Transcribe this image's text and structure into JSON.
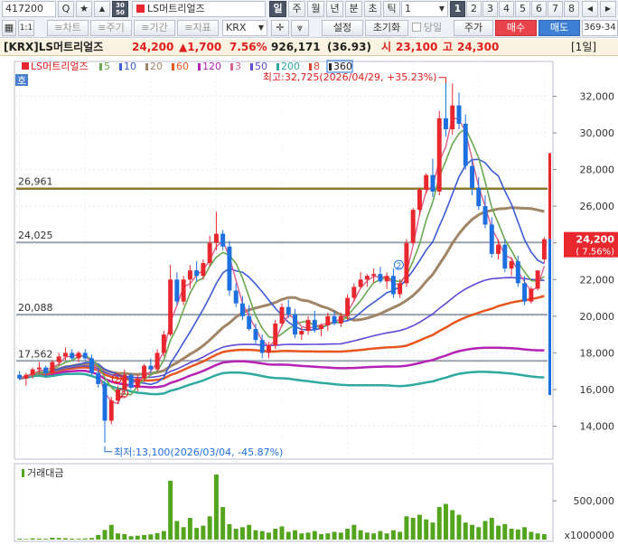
{
  "toolbar": {
    "code": "417200",
    "search_glyph": "Q",
    "star_glyph": "★",
    "up_glyph": "▲",
    "badge_top": "30",
    "badge_bottom": "50",
    "stock_name": "LS머트리얼즈",
    "period_buttons": [
      "일",
      "주",
      "월",
      "년",
      "분",
      "초",
      "틱"
    ],
    "interval_value": "1",
    "page_buttons": [
      "1",
      "2",
      "3",
      "4",
      "5",
      "6",
      "7",
      "8"
    ],
    "chart_btn": "≡차트",
    "cycle_btn": "≡주기",
    "range_btn": "≡기간",
    "indicator_btn": "≡지표",
    "market": "KRX",
    "settings_btn": "설정",
    "reset_btn": "초기화",
    "today_label": "당일",
    "price_btn": "주가",
    "buy_btn": "매수",
    "sell_btn": "매도",
    "range_label": "369-34",
    "small_btn": "1:1"
  },
  "info": {
    "exchange_name": "[KRX]LS머트리얼즈",
    "price": "24,200",
    "change": "▲1,700",
    "change_pct": "7.56%",
    "volume": "926,171",
    "turnover": "(36.93)",
    "open_label": "시",
    "open": "23,100",
    "high_label": "고",
    "high": "24,300",
    "period_tag": "[1일]"
  },
  "legend": {
    "name": "LS머트리얼즈",
    "ma": [
      {
        "label": "5",
        "color": "#6aa84f"
      },
      {
        "label": "10",
        "color": "#3d5bd6"
      },
      {
        "label": "20",
        "color": "#a08566"
      },
      {
        "label": "60",
        "color": "#e8561e"
      },
      {
        "label": "120",
        "color": "#b522b5"
      },
      {
        "label": "3",
        "color": "#e05f8a"
      },
      {
        "label": "50",
        "color": "#5b4bd6"
      },
      {
        "label": "200",
        "color": "#2eaaa0"
      },
      {
        "label": "8",
        "color": "#d9452f"
      },
      {
        "label": "360",
        "color": "#222222"
      }
    ],
    "small_tag": "호"
  },
  "annotations": {
    "high_note": "최고:32,725(2026/04/29, +35.23%)",
    "low_note": "최저:13,100(2026/03/04, -45.87%)",
    "marker_2": "2"
  },
  "volume_panel": {
    "title": "거래대금",
    "unit": "x1000000",
    "tick_label": "500,000"
  },
  "colors": {
    "up": "#e8282e",
    "down": "#1e6fe0",
    "volume": "#52a51c",
    "hline_olive": "#8c7a2c",
    "hline_grey": "#9aa3ad"
  },
  "chart_data": {
    "type": "candlestick",
    "y_ticks": [
      14000,
      16000,
      18000,
      20000,
      22000,
      24000,
      26000,
      28000,
      30000,
      32000
    ],
    "y_tick_labels": [
      "14,000",
      "16,000",
      "18,000",
      "20,000",
      "22,000",
      "24,000",
      "26,000",
      "28,000",
      "30,000",
      "32,000"
    ],
    "ylim": [
      12300,
      33800
    ],
    "hlines": [
      {
        "value": 26961,
        "label": "26,961",
        "color": "#8c7a2c"
      },
      {
        "value": 24025,
        "label": "24,025",
        "color": "#9aa3ad"
      },
      {
        "value": 20088,
        "label": "20,088",
        "color": "#9aa3ad"
      },
      {
        "value": 17562,
        "label": "17,562",
        "color": "#9aa3ad"
      }
    ],
    "current_price_label": [
      "24,200",
      "( 7.56%)"
    ],
    "current_price": 24200,
    "candles": [
      [
        16800,
        17000,
        16500,
        16600
      ],
      [
        16600,
        16900,
        16200,
        16800
      ],
      [
        16800,
        17200,
        16600,
        17100
      ],
      [
        17100,
        17500,
        16900,
        17200
      ],
      [
        17200,
        17300,
        16700,
        16900
      ],
      [
        16900,
        17600,
        16800,
        17500
      ],
      [
        17500,
        18000,
        17300,
        17800
      ],
      [
        17800,
        18300,
        17600,
        18000
      ],
      [
        18000,
        18200,
        17600,
        17700
      ],
      [
        17700,
        18100,
        17500,
        18000
      ],
      [
        18000,
        18200,
        17600,
        17700
      ],
      [
        17700,
        17900,
        16800,
        16900
      ],
      [
        16900,
        17100,
        16100,
        16300
      ],
      [
        16300,
        16500,
        13100,
        14300
      ],
      [
        14300,
        15600,
        14100,
        15400
      ],
      [
        15400,
        16200,
        15200,
        16000
      ],
      [
        16000,
        17100,
        15800,
        16800
      ],
      [
        16800,
        16900,
        16000,
        16100
      ],
      [
        16100,
        16800,
        15900,
        16600
      ],
      [
        16600,
        17400,
        16400,
        17300
      ],
      [
        17300,
        17700,
        16900,
        17100
      ],
      [
        17100,
        18200,
        17000,
        18000
      ],
      [
        18000,
        19200,
        17800,
        19000
      ],
      [
        19000,
        22800,
        18900,
        22000
      ],
      [
        22000,
        22400,
        20600,
        20800
      ],
      [
        20800,
        22200,
        20600,
        22000
      ],
      [
        22000,
        22800,
        21500,
        22500
      ],
      [
        22500,
        23000,
        21900,
        22200
      ],
      [
        22200,
        23100,
        22000,
        22900
      ],
      [
        22900,
        24400,
        22700,
        24000
      ],
      [
        24000,
        25700,
        23600,
        24500
      ],
      [
        24500,
        24700,
        23600,
        23800
      ],
      [
        23800,
        24100,
        21100,
        21400
      ],
      [
        21400,
        21800,
        20500,
        20700
      ],
      [
        20700,
        21100,
        19800,
        20000
      ],
      [
        20000,
        20600,
        19200,
        19300
      ],
      [
        19300,
        19600,
        18500,
        18700
      ],
      [
        18700,
        19000,
        17700,
        18000
      ],
      [
        18000,
        18600,
        17700,
        18400
      ],
      [
        18400,
        19800,
        18200,
        19600
      ],
      [
        19600,
        20700,
        19400,
        20500
      ],
      [
        20500,
        20900,
        19900,
        20100
      ],
      [
        20100,
        20400,
        18800,
        19000
      ],
      [
        19000,
        19400,
        18700,
        19200
      ],
      [
        19200,
        20000,
        19000,
        19800
      ],
      [
        19800,
        20300,
        19100,
        19300
      ],
      [
        19300,
        19600,
        18900,
        19500
      ],
      [
        19500,
        20200,
        19200,
        20000
      ],
      [
        20000,
        20300,
        19500,
        19600
      ],
      [
        19600,
        20200,
        19400,
        20000
      ],
      [
        20000,
        21200,
        19800,
        21000
      ],
      [
        21000,
        21800,
        20800,
        21600
      ],
      [
        21600,
        22400,
        21500,
        22000
      ],
      [
        22000,
        22300,
        21600,
        22200
      ],
      [
        22200,
        22600,
        21800,
        22300
      ],
      [
        22300,
        22700,
        21800,
        21900
      ],
      [
        21900,
        22400,
        21500,
        22200
      ],
      [
        22200,
        22600,
        21000,
        21200
      ],
      [
        21200,
        22000,
        21000,
        21800
      ],
      [
        21800,
        24200,
        21600,
        24000
      ],
      [
        24000,
        25900,
        23900,
        25800
      ],
      [
        25800,
        27000,
        25500,
        26900
      ],
      [
        26900,
        27800,
        26700,
        27700
      ],
      [
        27700,
        28600,
        26500,
        26800
      ],
      [
        26800,
        31200,
        26600,
        30800
      ],
      [
        30800,
        32725,
        29800,
        30200
      ],
      [
        30200,
        32700,
        29900,
        31500
      ],
      [
        31500,
        32200,
        30200,
        30500
      ],
      [
        30500,
        31000,
        28000,
        28200
      ],
      [
        28200,
        28600,
        26600,
        27000
      ],
      [
        27000,
        27600,
        25800,
        26000
      ],
      [
        26000,
        26600,
        24800,
        25000
      ],
      [
        25000,
        25400,
        23200,
        23400
      ],
      [
        23400,
        24200,
        23100,
        23900
      ],
      [
        23900,
        24200,
        22400,
        22600
      ],
      [
        22600,
        23200,
        22200,
        23000
      ],
      [
        23000,
        23300,
        21600,
        21800
      ],
      [
        21800,
        22200,
        20600,
        20800
      ],
      [
        20800,
        21600,
        20700,
        21500
      ],
      [
        21500,
        22300,
        21400,
        22500
      ],
      [
        23100,
        24300,
        22900,
        24200
      ]
    ],
    "volume_values": [
      5,
      4,
      8,
      6,
      5,
      12,
      10,
      9,
      6,
      5,
      7,
      10,
      30,
      62,
      95,
      40,
      35,
      22,
      25,
      30,
      34,
      42,
      55,
      380,
      120,
      80,
      140,
      75,
      90,
      150,
      420,
      210,
      100,
      70,
      80,
      95,
      60,
      55,
      45,
      70,
      85,
      50,
      60,
      40,
      45,
      55,
      35,
      40,
      50,
      45,
      70,
      95,
      60,
      45,
      40,
      55,
      40,
      60,
      50,
      150,
      140,
      160,
      130,
      110,
      210,
      230,
      190,
      160,
      110,
      95,
      80,
      120,
      140,
      90,
      100,
      70,
      65,
      80,
      50,
      40,
      35
    ]
  }
}
